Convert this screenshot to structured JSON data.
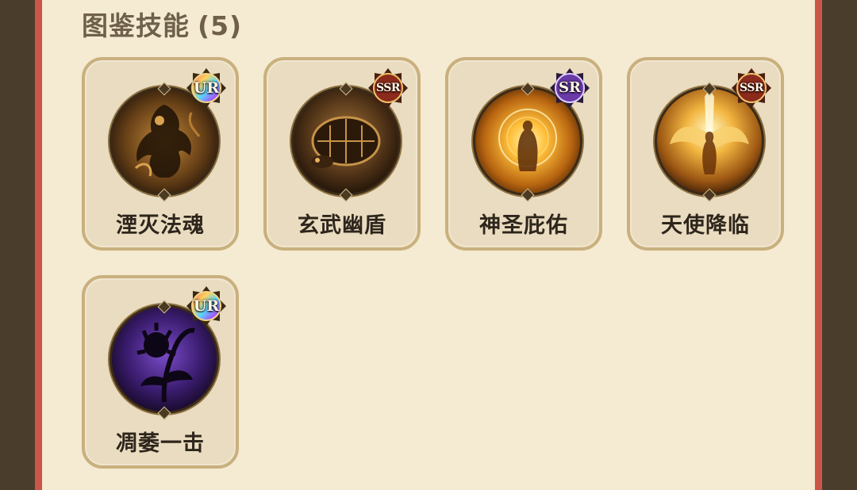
{
  "section": {
    "title": "图鉴技能",
    "count": "(5)"
  },
  "skills": [
    {
      "name": "湮灭法魂",
      "rarity": "UR",
      "icon": "earth-spirit-icon"
    },
    {
      "name": "玄武幽盾",
      "rarity": "SSR",
      "icon": "tortoise-shell-icon"
    },
    {
      "name": "神圣庇佑",
      "rarity": "SR",
      "icon": "holy-figure-icon"
    },
    {
      "name": "天使降临",
      "rarity": "SSR",
      "icon": "angel-wings-icon"
    },
    {
      "name": "凋萎一击",
      "rarity": "UR",
      "icon": "withered-flower-icon"
    }
  ],
  "colors": {
    "background": "#4a3d2b",
    "panel": "#f5ebd2",
    "border_accent": "#cd5548",
    "card_bg": "#e9dcc0",
    "card_border": "#c9b07e",
    "title_text": "#6f604c",
    "name_text": "#2e261c"
  }
}
